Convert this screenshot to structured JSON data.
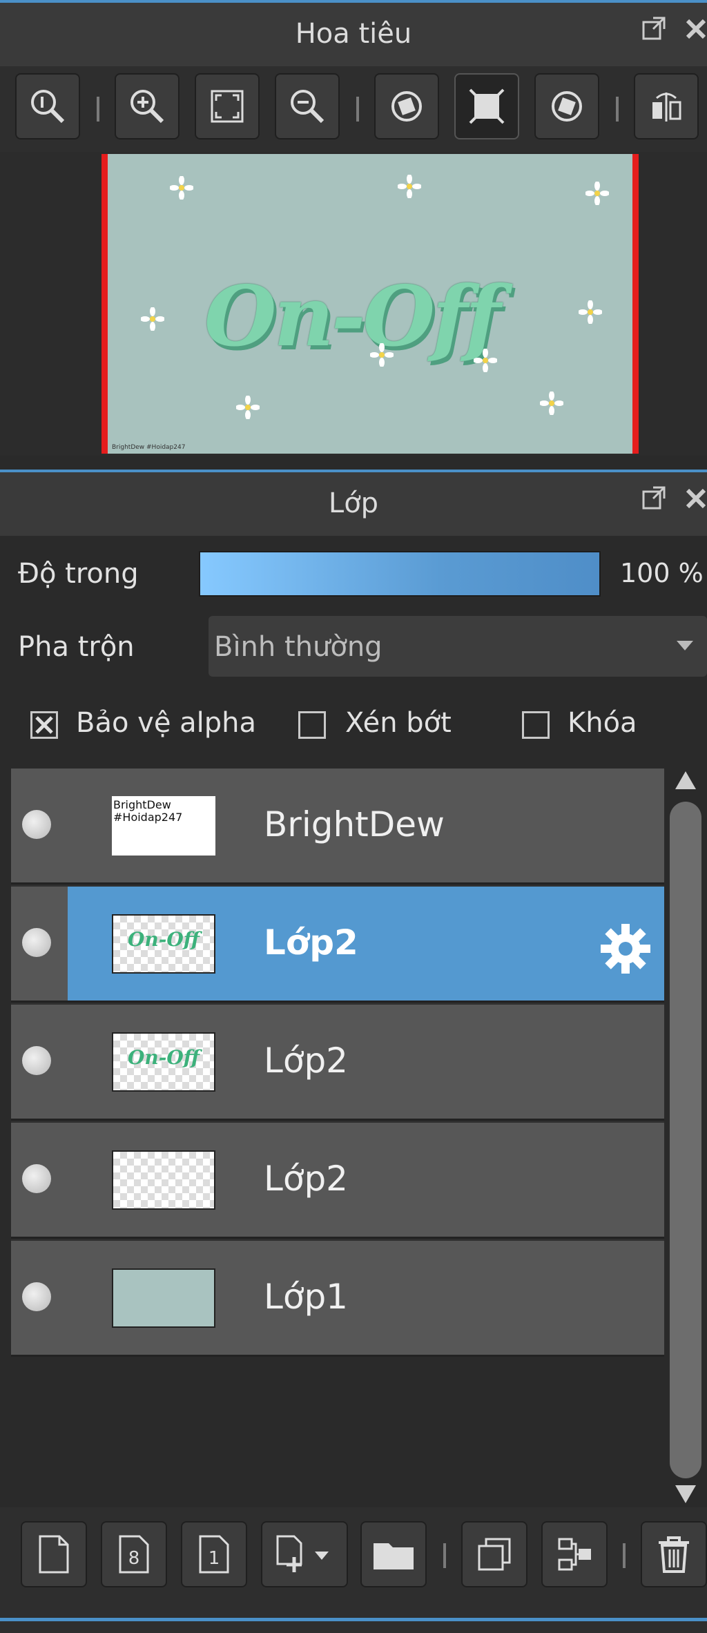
{
  "navigator": {
    "title": "Hoa tiêu"
  },
  "layers_panel": {
    "title": "Lớp",
    "opacity_label": "Độ trong",
    "opacity_value": 100,
    "opacity_text": "100 %",
    "blend_label": "Pha trộn",
    "blend_value": "Bình thường",
    "checkboxes": {
      "protect_alpha": {
        "label": "Bảo vệ alpha",
        "checked": true
      },
      "clipping": {
        "label": "Xén bớt",
        "checked": false
      },
      "lock": {
        "label": "Khóa",
        "checked": false
      }
    },
    "layers": [
      {
        "name": "BrightDew",
        "thumb_text": "BrightDew #Hoidap247",
        "selected": false
      },
      {
        "name": "Lớp2",
        "thumb_text": "On-Off",
        "selected": true
      },
      {
        "name": "Lớp2",
        "thumb_text": "On-Off",
        "selected": false
      },
      {
        "name": "Lớp2",
        "thumb_text": "",
        "selected": false
      },
      {
        "name": "Lớp1",
        "thumb_text": "",
        "selected": false
      }
    ]
  },
  "canvas": {
    "text": "On-Off",
    "corner_text": "BrightDew #Hoidap247",
    "background_color": "#a8c2be",
    "text_color": "#7fd4ad"
  },
  "colors": {
    "accent": "#4a90c8",
    "selected_layer": "#5499d0",
    "canvas_border": "#e51d1d"
  }
}
